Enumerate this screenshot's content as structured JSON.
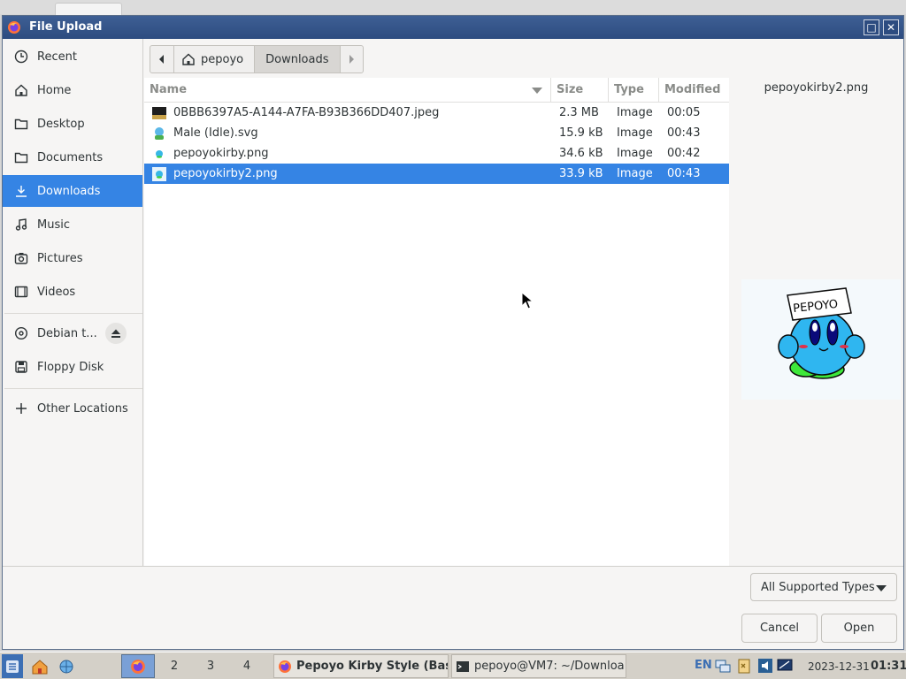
{
  "window": {
    "title": "File Upload",
    "maximize_label": "□",
    "close_label": "✕"
  },
  "sidebar": {
    "items": [
      {
        "label": "Recent",
        "icon": "clock-icon"
      },
      {
        "label": "Home",
        "icon": "home-icon"
      },
      {
        "label": "Desktop",
        "icon": "folder-icon"
      },
      {
        "label": "Documents",
        "icon": "folder-icon"
      },
      {
        "label": "Downloads",
        "icon": "download-icon",
        "selected": true
      },
      {
        "label": "Music",
        "icon": "music-icon"
      },
      {
        "label": "Pictures",
        "icon": "camera-icon"
      },
      {
        "label": "Videos",
        "icon": "video-icon"
      },
      {
        "label": "Debian t...",
        "icon": "disc-icon"
      },
      {
        "label": "Floppy Disk",
        "icon": "floppy-icon"
      },
      {
        "label": "Other Locations",
        "icon": "plus-icon"
      }
    ]
  },
  "pathbar": {
    "home_label": "pepoyo",
    "current_label": "Downloads"
  },
  "filelist": {
    "columns": {
      "name": "Name",
      "size": "Size",
      "type": "Type",
      "modified": "Modified"
    },
    "rows": [
      {
        "name": "0BBB6397A5-A144-A7FA-B93B366DD407.jpeg",
        "size": "2.3 MB",
        "type": "Image",
        "modified": "00:05",
        "icon": "jpeg-thumbnail-icon"
      },
      {
        "name": "Male (Idle).svg",
        "size": "15.9 kB",
        "type": "Image",
        "modified": "00:43",
        "icon": "svg-thumbnail-icon"
      },
      {
        "name": "pepoyokirby.png",
        "size": "34.6 kB",
        "type": "Image",
        "modified": "00:42",
        "icon": "png-thumbnail-icon"
      },
      {
        "name": "pepoyokirby2.png",
        "size": "33.9 kB",
        "type": "Image",
        "modified": "00:43",
        "icon": "png-thumbnail-icon",
        "selected": true
      }
    ]
  },
  "preview": {
    "filename": "pepoyokirby2.png",
    "image_text": "PEPOYO"
  },
  "filter": {
    "selected": "All Supported Types"
  },
  "buttons": {
    "cancel": "Cancel",
    "open": "Open"
  },
  "taskbar": {
    "workspaces": [
      "2",
      "3",
      "4"
    ],
    "tasks": [
      {
        "label": "Pepoyo Kirby Style (Bas",
        "icon": "firefox-icon"
      },
      {
        "label": "pepoyo@VM7: ~/Downloa",
        "icon": "terminal-icon"
      }
    ],
    "keyboard_layout": "EN",
    "date": "2023-12-31",
    "time": "01:31"
  },
  "colors": {
    "accent": "#3584e4",
    "titlebar": "#2d4c80",
    "sidebar_bg": "#f6f5f4"
  }
}
